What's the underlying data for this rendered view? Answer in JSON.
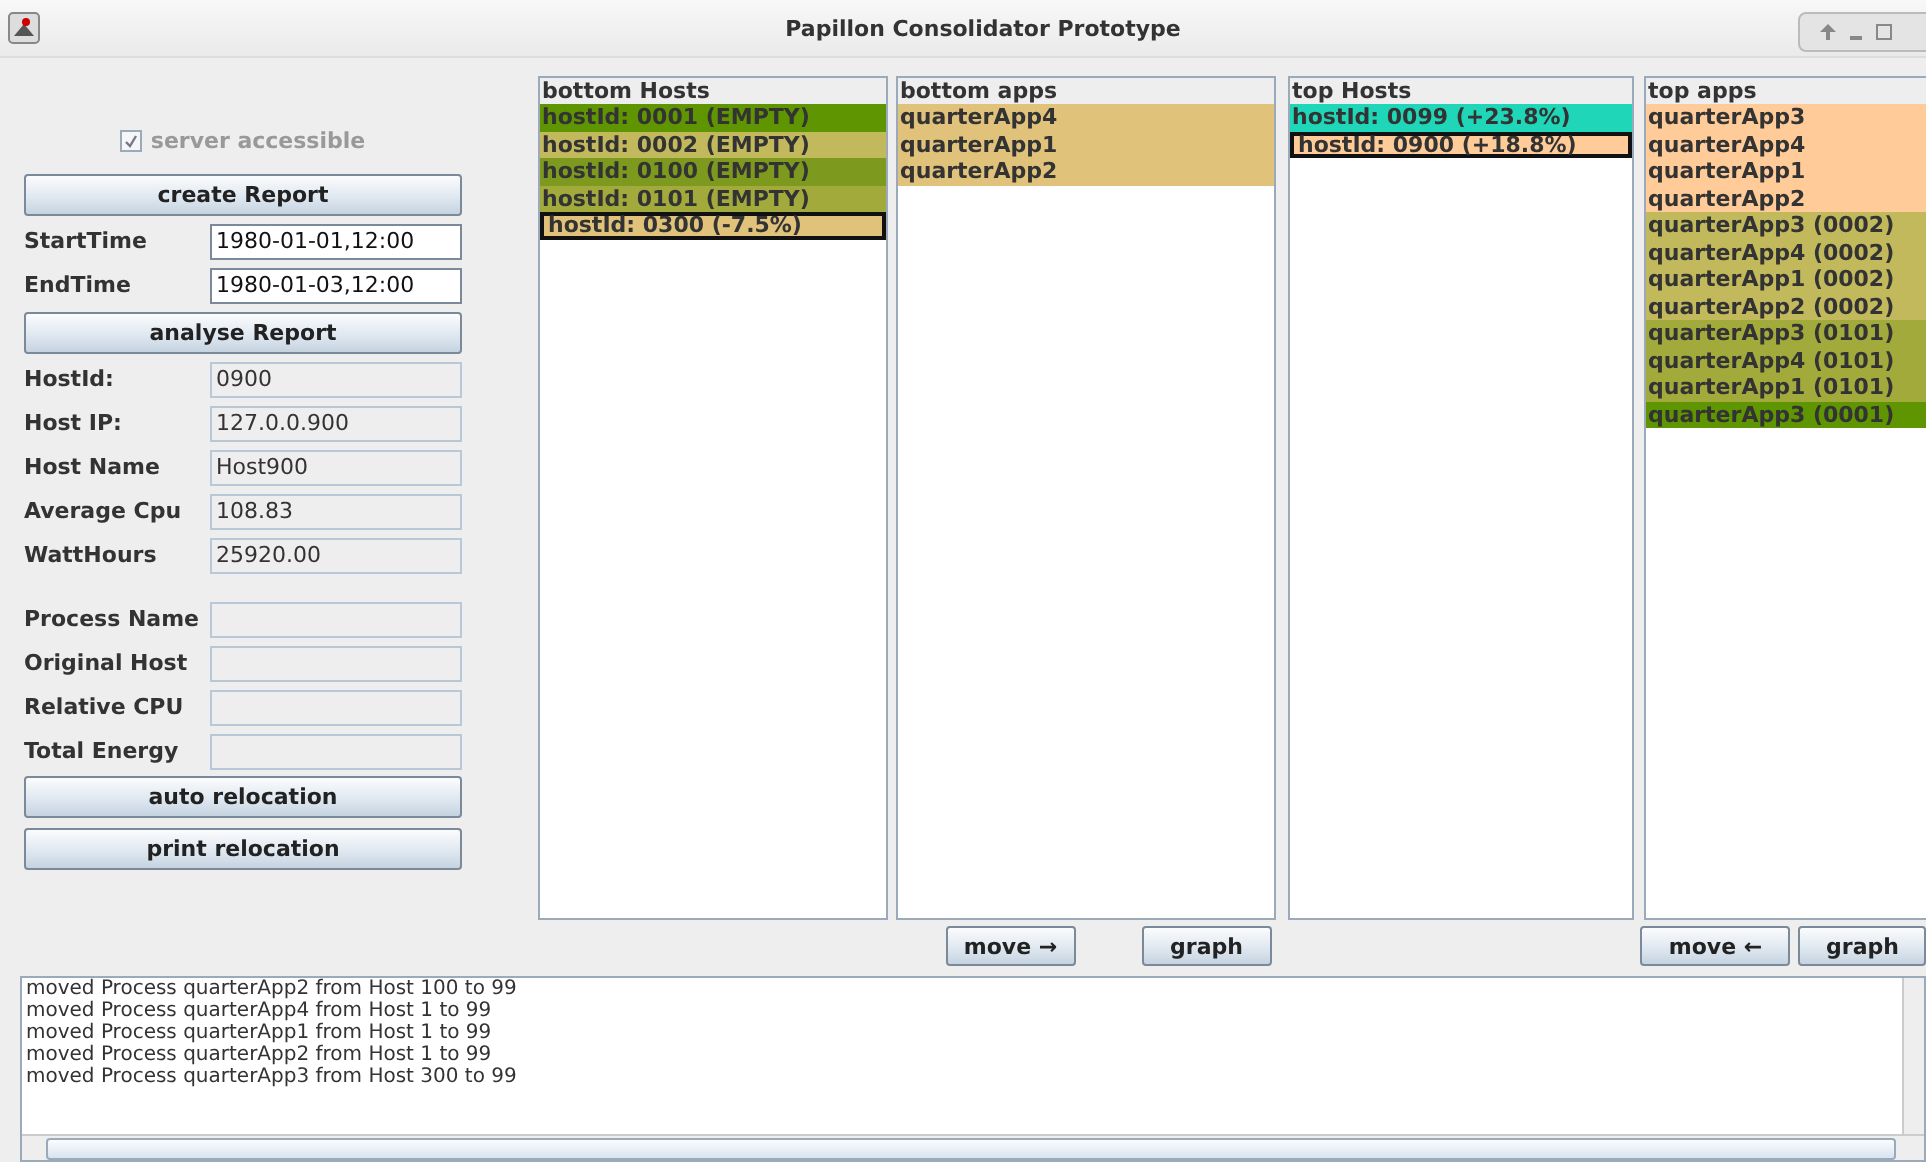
{
  "window": {
    "title": "Papillon Consolidator Prototype"
  },
  "server_accessible": {
    "label": "server accessible",
    "checked": true,
    "disabled": true
  },
  "create_button": "create Report",
  "time_fields": [
    {
      "label": "StartTime",
      "value": "1980-01-01,12:00"
    },
    {
      "label": "EndTime",
      "value": "1980-01-03,12:00"
    }
  ],
  "analyse_button": "analyse Report",
  "host_fields": [
    {
      "label": "HostId:",
      "value": "0900"
    },
    {
      "label": "Host IP:",
      "value": "127.0.0.900"
    },
    {
      "label": "Host Name",
      "value": "Host900"
    },
    {
      "label": "Average Cpu",
      "value": "108.83"
    },
    {
      "label": "WattHours",
      "value": "25920.00"
    }
  ],
  "process_fields": [
    {
      "label": "Process Name"
    },
    {
      "label": "Original Host"
    },
    {
      "label": "Relative CPU"
    },
    {
      "label": "Total Energy"
    }
  ],
  "relocation_buttons": [
    "auto relocation",
    "print relocation"
  ],
  "lists": [
    {
      "title": "bottom Hosts",
      "items": [
        {
          "text": "hostId: 0001 (EMPTY)",
          "color": "#5f9500",
          "selected": false
        },
        {
          "text": "hostId: 0002 (EMPTY)",
          "color": "#c2b85c",
          "selected": false
        },
        {
          "text": "hostId: 0100 (EMPTY)",
          "color": "#7d9a1e",
          "selected": false
        },
        {
          "text": "hostId: 0101 (EMPTY)",
          "color": "#a3aa3c",
          "selected": false
        },
        {
          "text": "hostId: 0300 (-7.5%)",
          "color": "#e0c27a",
          "selected": true
        }
      ]
    },
    {
      "title": "bottom apps",
      "items": [
        {
          "text": "quarterApp4",
          "color": "#e0c27a",
          "selected": false
        },
        {
          "text": "quarterApp1",
          "color": "#e0c27a",
          "selected": false
        },
        {
          "text": "quarterApp2",
          "color": "#e0c27a",
          "selected": false
        }
      ]
    },
    {
      "title": "top Hosts",
      "items": [
        {
          "text": "hostId: 0099 (+23.8%)",
          "color": "#1fd6b8",
          "selected": false
        },
        {
          "text": "hostId: 0900 (+18.8%)",
          "color": "#ffcc99",
          "selected": true
        }
      ]
    },
    {
      "title": "top apps",
      "items": [
        {
          "text": "quarterApp3",
          "color": "#ffcc99",
          "selected": false
        },
        {
          "text": "quarterApp4",
          "color": "#ffcc99",
          "selected": false
        },
        {
          "text": "quarterApp1",
          "color": "#ffcc99",
          "selected": false
        },
        {
          "text": "quarterApp2",
          "color": "#ffcc99",
          "selected": false
        },
        {
          "text": "quarterApp3 (0002)",
          "color": "#c2b85c",
          "selected": false
        },
        {
          "text": "quarterApp4 (0002)",
          "color": "#c2b85c",
          "selected": false
        },
        {
          "text": "quarterApp1 (0002)",
          "color": "#c2b85c",
          "selected": false
        },
        {
          "text": "quarterApp2 (0002)",
          "color": "#c2b85c",
          "selected": false
        },
        {
          "text": "quarterApp3 (0101)",
          "color": "#a3aa3c",
          "selected": false
        },
        {
          "text": "quarterApp4 (0101)",
          "color": "#a3aa3c",
          "selected": false
        },
        {
          "text": "quarterApp1 (0101)",
          "color": "#a3aa3c",
          "selected": false
        },
        {
          "text": "quarterApp3 (0001)",
          "color": "#5f9500",
          "selected": false
        }
      ]
    }
  ],
  "bottom_buttons": [
    "move →",
    "graph"
  ],
  "top_buttons": [
    "move ←",
    "graph"
  ],
  "log": [
    "moved Process quarterApp2 from Host 100 to 99",
    "moved Process quarterApp4 from Host 1 to 99",
    "moved Process quarterApp1 from Host 1 to 99",
    "moved Process quarterApp2 from Host 1 to 99",
    "moved Process quarterApp3 from Host 300 to 99"
  ]
}
